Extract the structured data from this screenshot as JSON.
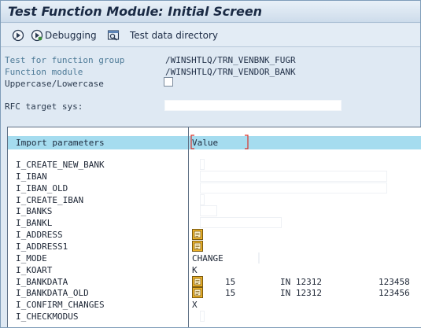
{
  "window": {
    "title": "Test Function Module: Initial Screen"
  },
  "toolbar": {
    "execute_icon": "execute-icon",
    "debug_icon": "debugging-icon",
    "debugging_label": "Debugging",
    "directory_icon": "test-data-directory-icon",
    "test_data_label": "Test data directory"
  },
  "form": {
    "fg_label": "Test for function group",
    "fg_value": "/WINSHTLQ/TRN_VENBNK_FUGR",
    "fm_label": "Function module",
    "fm_value": "/WINSHTLQ/TRN_VENDOR_BANK",
    "case_label": "Uppercase/Lowercase",
    "case_checked": false,
    "rfc_label": "RFC target sys:",
    "rfc_value": ""
  },
  "table": {
    "col_param": "Import parameters",
    "col_value": "Value",
    "rows": [
      {
        "name": "I_CREATE_NEW_BANK",
        "value": ""
      },
      {
        "name": "I_IBAN",
        "value": ""
      },
      {
        "name": "I_IBAN_OLD",
        "value": ""
      },
      {
        "name": "I_CREATE_IBAN",
        "value": ""
      },
      {
        "name": "I_BANKS",
        "value": ""
      },
      {
        "name": "I_BANKL",
        "value": ""
      },
      {
        "name": "I_ADDRESS",
        "value": ""
      },
      {
        "name": "I_ADDRESS1",
        "value": ""
      },
      {
        "name": "I_MODE",
        "value": "CHANGE"
      },
      {
        "name": "I_KOART",
        "value": "K"
      },
      {
        "name": "I_BANKDATA",
        "v1": "15",
        "v2": "IN 12312",
        "v3": "123458"
      },
      {
        "name": "I_BANKDATA_OLD",
        "v1": "15",
        "v2": "IN 12312",
        "v3": "123456"
      },
      {
        "name": "I_CONFIRM_CHANGES",
        "value": "X"
      },
      {
        "name": "I_CHECKMODUS",
        "value": ""
      }
    ]
  },
  "colors": {
    "header_bg": "#a5dcef",
    "label_blue": "#4d7a97",
    "accent_red": "#d9342b"
  }
}
